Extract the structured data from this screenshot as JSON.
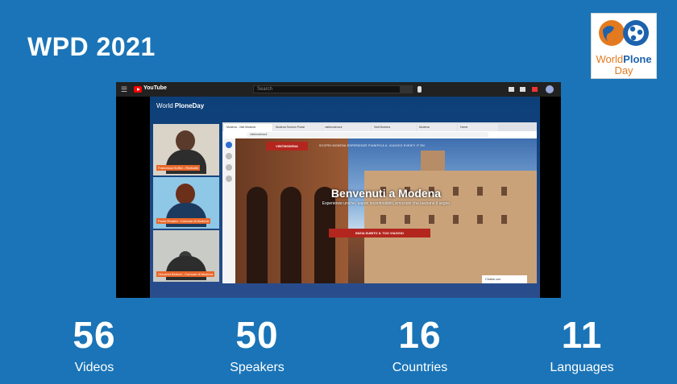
{
  "title": "WPD 2021",
  "logo": {
    "line1_a": "World",
    "line1_b": "Plone",
    "line2": "Day"
  },
  "youtube": {
    "menu_icon": "hamburger-icon",
    "brand": "YouTube",
    "search_placeholder": "Search"
  },
  "stream": {
    "brand_a": "World",
    "brand_b": "PloneDay",
    "participants": [
      {
        "name": "Francesca Soffici - Redturtle"
      },
      {
        "name": "Paola Rossini - Comune di Modena"
      },
      {
        "name": "Giovanni Bertoni - Comune di Modena"
      }
    ],
    "browser": {
      "tabs": [
        "Modena - Visit Modena",
        "Modena Tourism Portal",
        "visitmodena.it",
        "Visit Modena",
        "Modena",
        "Home"
      ],
      "url": "visitmodena.it",
      "site": {
        "nav_button": "VISITMODENA",
        "menu": "SCOPRI MODENA  ESPERIENZE  PIANIFICA IL VIAGGIO  EVENTI  IT  EN",
        "hero_title": "Benvenuti a Modena",
        "hero_subtitle": "Esperienze uniche, sapori inconfondibili, emozioni che lasciano il segno",
        "cta": "INIZIA SUBITO IL TUO VIAGGIO",
        "chat": "Chatta con"
      }
    }
  },
  "stats": [
    {
      "value": "56",
      "label": "Videos"
    },
    {
      "value": "50",
      "label": "Speakers"
    },
    {
      "value": "16",
      "label": "Countries"
    },
    {
      "value": "11",
      "label": "Languages"
    }
  ],
  "colors": {
    "background": "#1a74b7",
    "accent": "#e37a1f",
    "brand_blue": "#1d62ad"
  }
}
